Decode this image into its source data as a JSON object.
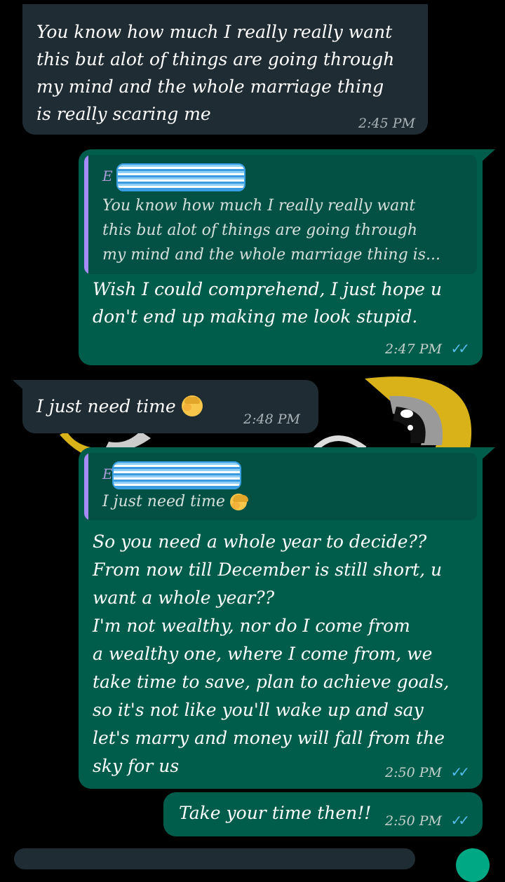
{
  "messages": [
    {
      "direction": "incoming",
      "text": "You know how much I really really want\nthis but alot of things are going through\nmy mind and the whole marriage thing\nis really scaring me",
      "time": "2:45 PM"
    },
    {
      "direction": "outgoing",
      "quote_author": "E",
      "quote_text": "You know how much I really really want\nthis but alot of things are going through\nmy mind and the whole marriage thing is...",
      "text": "Wish I could comprehend,  I just hope u\ndon't end up making me look stupid.",
      "time": "2:47 PM",
      "status": "read"
    },
    {
      "direction": "incoming",
      "text": "I just need time",
      "emoji": "face-palm-emoji",
      "time": "2:48 PM"
    },
    {
      "direction": "outgoing",
      "quote_author": "E",
      "quote_text": "I just need time",
      "quote_emoji": "face-palm-emoji",
      "text": "So you need a whole year to decide??\nFrom now till December is still short, u\nwant a whole year??\nI'm not wealthy, nor do I come from\na wealthy one, where I come from, we\ntake time to save, plan to achieve goals,\nso it's not like you'll wake up and say\nlet's marry and money will fall from the\nsky for us",
      "time": "2:50 PM",
      "status": "read"
    },
    {
      "direction": "outgoing",
      "text": "Take your time then!!",
      "time": "2:50 PM",
      "status": "read"
    }
  ],
  "colors": {
    "background": "#000000",
    "incoming_bubble": "#202c33",
    "outgoing_bubble": "#005c4b",
    "read_ticks": "#53bdeb",
    "wallpaper_accent": "#d9b21a"
  },
  "icons": {
    "read_receipt": "double-check-icon"
  }
}
